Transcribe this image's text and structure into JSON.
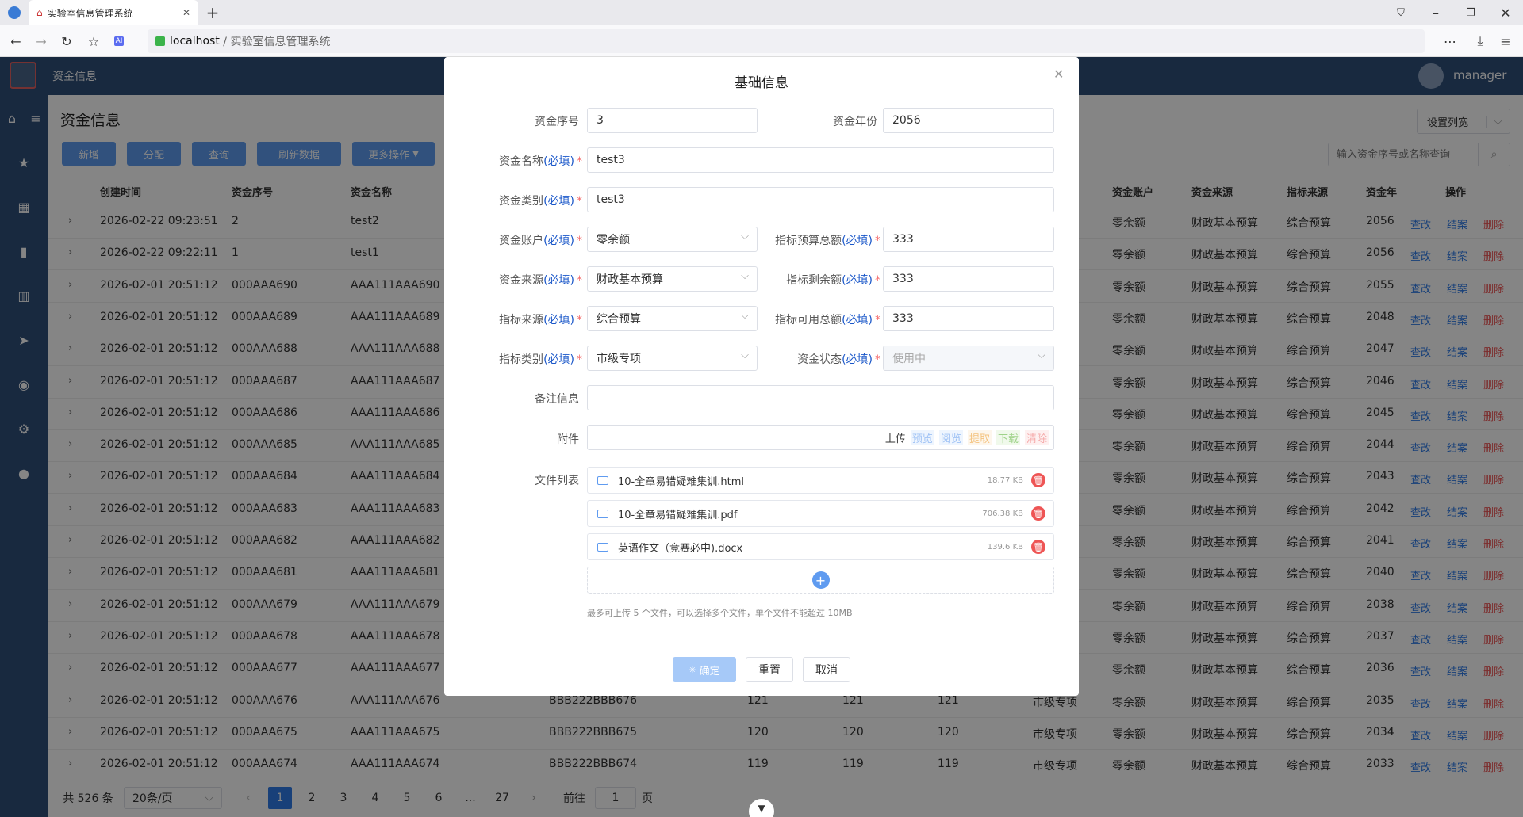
{
  "browser": {
    "tab_title": "实验室信息管理系统",
    "url_host": "localhost",
    "url_path": " / 实验室信息管理系统"
  },
  "app": {
    "header_title": "资金信息",
    "user": "manager",
    "page_title": "资金信息",
    "toolbar": {
      "add": "新增",
      "assign": "分配",
      "query": "查询",
      "refresh": "刷新数据",
      "more": "更多操作"
    },
    "column_settings": "设置列宽",
    "search_placeholder": "输入资金序号或名称查询",
    "columns": [
      "创建时间",
      "资金序号",
      "资金名称",
      "资金账户",
      "资金来源",
      "指标来源",
      "资金年",
      "操作"
    ],
    "rows": [
      {
        "time": "2026-02-22 09:23:51",
        "no": "2",
        "name": "test2",
        "acct": "零余额",
        "src": "财政基本预算",
        "idx": "综合预算",
        "year": "2056"
      },
      {
        "time": "2026-02-22 09:22:11",
        "no": "1",
        "name": "test1",
        "acct": "零余额",
        "src": "财政基本预算",
        "idx": "综合预算",
        "year": "2056"
      },
      {
        "time": "2026-02-01 20:51:12",
        "no": "000AAA690",
        "name": "AAA111AAA690",
        "acct": "零余额",
        "src": "财政基本预算",
        "idx": "综合预算",
        "year": "2055"
      },
      {
        "time": "2026-02-01 20:51:12",
        "no": "000AAA689",
        "name": "AAA111AAA689",
        "acct": "零余额",
        "src": "财政基本预算",
        "idx": "综合预算",
        "year": "2048"
      },
      {
        "time": "2026-02-01 20:51:12",
        "no": "000AAA688",
        "name": "AAA111AAA688",
        "acct": "零余额",
        "src": "财政基本预算",
        "idx": "综合预算",
        "year": "2047"
      },
      {
        "time": "2026-02-01 20:51:12",
        "no": "000AAA687",
        "name": "AAA111AAA687",
        "acct": "零余额",
        "src": "财政基本预算",
        "idx": "综合预算",
        "year": "2046"
      },
      {
        "time": "2026-02-01 20:51:12",
        "no": "000AAA686",
        "name": "AAA111AAA686",
        "acct": "零余额",
        "src": "财政基本预算",
        "idx": "综合预算",
        "year": "2045"
      },
      {
        "time": "2026-02-01 20:51:12",
        "no": "000AAA685",
        "name": "AAA111AAA685",
        "acct": "零余额",
        "src": "财政基本预算",
        "idx": "综合预算",
        "year": "2044"
      },
      {
        "time": "2026-02-01 20:51:12",
        "no": "000AAA684",
        "name": "AAA111AAA684",
        "acct": "零余额",
        "src": "财政基本预算",
        "idx": "综合预算",
        "year": "2043"
      },
      {
        "time": "2026-02-01 20:51:12",
        "no": "000AAA683",
        "name": "AAA111AAA683",
        "acct": "零余额",
        "src": "财政基本预算",
        "idx": "综合预算",
        "year": "2042"
      },
      {
        "time": "2026-02-01 20:51:12",
        "no": "000AAA682",
        "name": "AAA111AAA682",
        "acct": "零余额",
        "src": "财政基本预算",
        "idx": "综合预算",
        "year": "2041"
      },
      {
        "time": "2026-02-01 20:51:12",
        "no": "000AAA681",
        "name": "AAA111AAA681",
        "acct": "零余额",
        "src": "财政基本预算",
        "idx": "综合预算",
        "year": "2040"
      },
      {
        "time": "2026-02-01 20:51:12",
        "no": "000AAA679",
        "name": "AAA111AAA679",
        "acct": "零余额",
        "src": "财政基本预算",
        "idx": "综合预算",
        "year": "2038"
      },
      {
        "time": "2026-02-01 20:51:12",
        "no": "000AAA678",
        "name": "AAA111AAA678",
        "acct": "零余额",
        "src": "财政基本预算",
        "idx": "综合预算",
        "year": "2037"
      },
      {
        "time": "2026-02-01 20:51:12",
        "no": "000AAA677",
        "name": "AAA111AAA677",
        "acct": "零余额",
        "src": "财政基本预算",
        "idx": "综合预算",
        "year": "2036"
      },
      {
        "time": "2026-02-01 20:51:12",
        "no": "000AAA676",
        "name": "AAA111AAA676",
        "cat": "BBB222BBB676",
        "b1": "121",
        "b2": "121",
        "b3": "121",
        "type": "市级专项",
        "acct": "零余额",
        "src": "财政基本预算",
        "idx": "综合预算",
        "year": "2035"
      },
      {
        "time": "2026-02-01 20:51:12",
        "no": "000AAA675",
        "name": "AAA111AAA675",
        "cat": "BBB222BBB675",
        "b1": "120",
        "b2": "120",
        "b3": "120",
        "type": "市级专项",
        "acct": "零余额",
        "src": "财政基本预算",
        "idx": "综合预算",
        "year": "2034"
      },
      {
        "time": "2026-02-01 20:51:12",
        "no": "000AAA674",
        "name": "AAA111AAA674",
        "cat": "BBB222BBB674",
        "b1": "119",
        "b2": "119",
        "b3": "119",
        "type": "市级专项",
        "acct": "零余额",
        "src": "财政基本预算",
        "idx": "综合预算",
        "year": "2033"
      }
    ],
    "row_actions": {
      "edit": "查改",
      "close": "结案",
      "delete": "删除"
    },
    "pagination": {
      "total": "共 526 条",
      "page_size": "20条/页",
      "pages": [
        "1",
        "2",
        "3",
        "4",
        "5",
        "6",
        "...",
        "27"
      ],
      "current": "1",
      "goto_label": "前往",
      "goto_value": "1",
      "page_unit": "页"
    }
  },
  "modal": {
    "title": "基础信息",
    "required_mark": "(必填)",
    "fields": {
      "fund_no": {
        "label": "资金序号",
        "value": "3"
      },
      "fund_year": {
        "label": "资金年份",
        "value": "2056"
      },
      "fund_name": {
        "label": "资金名称",
        "value": "test3"
      },
      "fund_category": {
        "label": "资金类别",
        "value": "test3"
      },
      "fund_account": {
        "label": "资金账户",
        "value": "零余额"
      },
      "budget_total": {
        "label": "指标预算总额",
        "value": "333"
      },
      "fund_source": {
        "label": "资金来源",
        "value": "财政基本预算"
      },
      "budget_remain": {
        "label": "指标剩余额",
        "value": "333"
      },
      "index_source": {
        "label": "指标来源",
        "value": "综合预算"
      },
      "budget_available": {
        "label": "指标可用总额",
        "value": "333"
      },
      "index_category": {
        "label": "指标类别",
        "value": "市级专项"
      },
      "fund_status": {
        "label": "资金状态",
        "value": "使用中"
      },
      "remark": {
        "label": "备注信息",
        "value": ""
      },
      "attachment": {
        "label": "附件"
      }
    },
    "attachment_actions": {
      "upload": "上传",
      "preview": "预览",
      "read": "阅览",
      "extract": "提取",
      "download": "下载",
      "clear": "清除"
    },
    "file_list_label": "文件列表",
    "files": [
      {
        "name": "10-全章易错疑难集训.html",
        "size": "18.77 KB"
      },
      {
        "name": "10-全章易错疑难集训.pdf",
        "size": "706.38 KB"
      },
      {
        "name": "英语作文（竞赛必中).docx",
        "size": "139.6 KB"
      }
    ],
    "upload_hint": "最多可上传 5 个文件，可以选择多个文件，单个文件不能超过 10MB",
    "buttons": {
      "confirm": "确定",
      "reset": "重置",
      "cancel": "取消"
    }
  }
}
